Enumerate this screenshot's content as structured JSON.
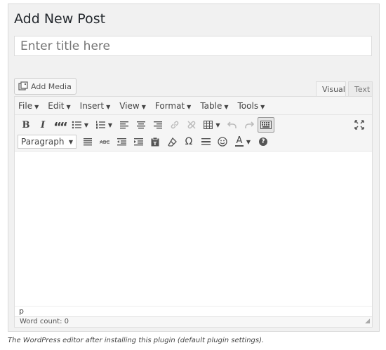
{
  "page": {
    "title": "Add New Post",
    "title_placeholder": "Enter title here"
  },
  "media": {
    "add_media_label": "Add Media",
    "icon": "media-icon"
  },
  "tabs": [
    {
      "label": "Visual",
      "active": true
    },
    {
      "label": "Text",
      "active": false
    }
  ],
  "menubar": [
    {
      "label": "File"
    },
    {
      "label": "Edit"
    },
    {
      "label": "Insert"
    },
    {
      "label": "View"
    },
    {
      "label": "Format"
    },
    {
      "label": "Table"
    },
    {
      "label": "Tools"
    }
  ],
  "toolbar": {
    "row1_buttons": [
      "bold-icon",
      "italic-icon",
      "blockquote-icon",
      "bullet-list-icon",
      "numbered-list-icon",
      "align-left-icon",
      "align-center-icon",
      "align-right-icon",
      "link-icon",
      "unlink-icon",
      "table-icon",
      "undo-icon",
      "redo-icon",
      "toolbar-toggle-icon",
      "fullscreen-icon"
    ],
    "row2_buttons": [
      "justify-icon",
      "strikethrough-icon",
      "outdent-icon",
      "indent-icon",
      "paste-text-icon",
      "clear-format-icon",
      "omega-icon",
      "horizontal-line-icon",
      "emoticon-icon",
      "text-color-icon",
      "help-icon"
    ],
    "format_select": "Paragraph",
    "bold_glyph": "B",
    "italic_glyph": "I",
    "quote_glyph": "““",
    "omega_glyph": "Ω",
    "textcolor_glyph": "A",
    "help_glyph": "?"
  },
  "editor": {
    "path": "p",
    "word_count": "Word count: 0"
  },
  "caption": "The WordPress editor after installing this plugin (default plugin settings)."
}
